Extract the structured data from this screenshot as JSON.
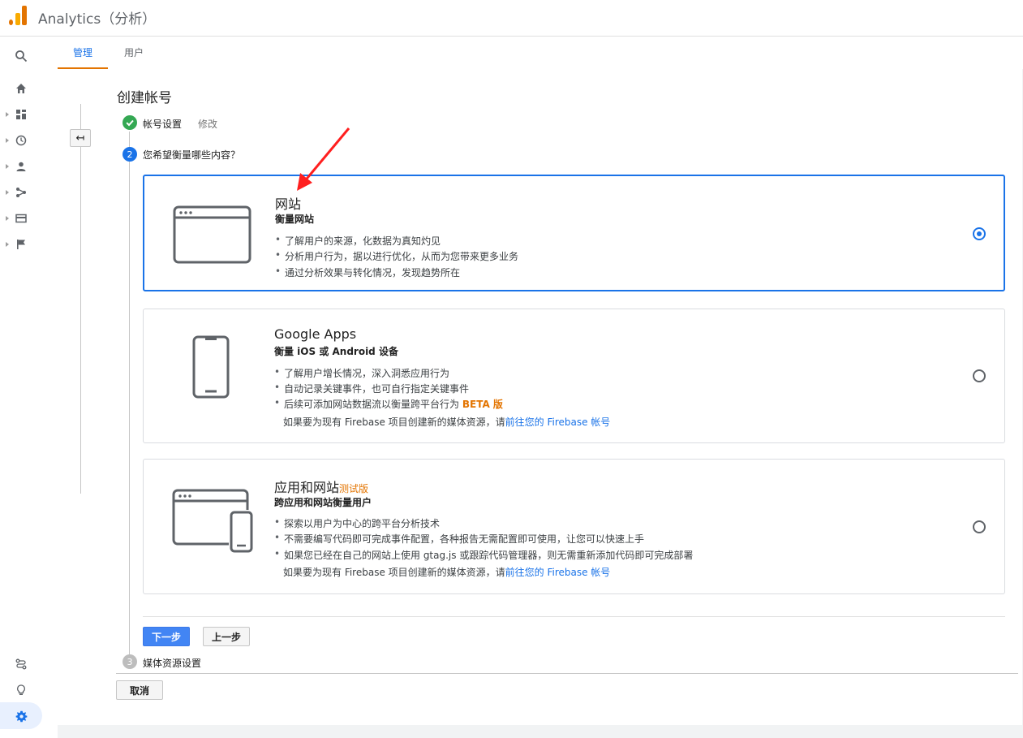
{
  "header": {
    "app_title": "Analytics（分析）"
  },
  "tabs": [
    {
      "label": "管理"
    },
    {
      "label": "用户"
    }
  ],
  "page_title": "创建帐号",
  "steps": {
    "step1": {
      "label": "帐号设置",
      "edit": "修改"
    },
    "step2": {
      "number": "2",
      "label": "您希望衡量哪些内容？"
    },
    "step3": {
      "number": "3",
      "label": "媒体资源设置"
    }
  },
  "options": [
    {
      "title": "网站",
      "subtitle": "衡量网站",
      "bullets": [
        "了解用户的来源，化数据为真知灼见",
        "分析用户行为，据以进行优化，从而为您带来更多业务",
        "通过分析效果与转化情况，发现趋势所在"
      ],
      "selected": true
    },
    {
      "title": "Google Apps",
      "subtitle": "衡量 iOS 或 Android 设备",
      "bullets": [
        "了解用户增长情况，深入洞悉应用行为",
        "自动记录关键事件，也可自行指定关键事件",
        "后续可添加网站数据流以衡量跨平台行为"
      ],
      "beta": "BETA 版",
      "note_prefix": "如果要为现有 Firebase 项目创建新的媒体资源，请",
      "note_link": "前往您的 Firebase 帐号",
      "selected": false
    },
    {
      "title": "应用和网站",
      "badge": "测试版",
      "subtitle": "跨应用和网站衡量用户",
      "bullets": [
        "探索以用户为中心的跨平台分析技术",
        "不需要编写代码即可完成事件配置，各种报告无需配置即可使用，让您可以快速上手",
        "如果您已经在自己的网站上使用 gtag.js 或跟踪代码管理器，则无需重新添加代码即可完成部署"
      ],
      "note_prefix": "如果要为现有 Firebase 项目创建新的媒体资源，请",
      "note_link": "前往您的 Firebase 帐号",
      "selected": false
    }
  ],
  "buttons": {
    "next": "下一步",
    "prev": "上一步",
    "cancel": "取消",
    "back": "↤"
  },
  "colors": {
    "accent": "#1a73e8",
    "tab_underline": "#e37400",
    "check": "#34a853",
    "arrow": "#ff1f1f",
    "beta": "#e37400"
  },
  "icons": [
    "search-icon",
    "home-icon",
    "dashboard-icon",
    "clock-icon",
    "person-icon",
    "share-icon",
    "card-icon",
    "flag-icon",
    "route-icon",
    "lightbulb-icon",
    "gear-icon"
  ]
}
